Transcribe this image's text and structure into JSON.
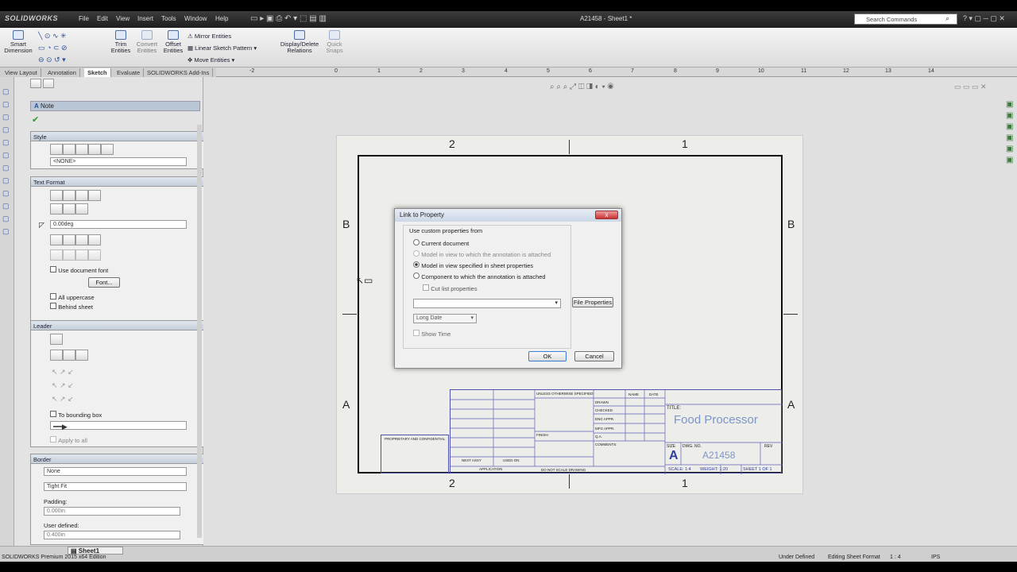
{
  "app": {
    "logo": "SOLIDWORKS",
    "document_title": "A21458 - Sheet1 *",
    "menus": [
      "File",
      "Edit",
      "View",
      "Insert",
      "Tools",
      "Window",
      "Help"
    ],
    "search_placeholder": "Search Commands"
  },
  "ribbon": {
    "smart_dimension": "Smart Dimension",
    "trim": "Trim Entities",
    "convert": "Convert Entities",
    "offset": "Offset Entities",
    "mirror": "Mirror Entities",
    "linear_pattern": "Linear Sketch Pattern",
    "move": "Move Entities",
    "display_delete": "Display/Delete Relations",
    "quick_snaps": "Quick Snaps"
  },
  "tabs": [
    "View Layout",
    "Annotation",
    "Sketch",
    "Evaluate",
    "SOLIDWORKS Add-Ins"
  ],
  "active_tab": "Sketch",
  "ruler": [
    "-2",
    "0",
    "1",
    "2",
    "3",
    "4",
    "5",
    "6",
    "7",
    "8",
    "9",
    "10",
    "11",
    "12",
    "13",
    "14"
  ],
  "property_manager": {
    "title": "Note",
    "style": {
      "header": "Style",
      "combo": "<NONE>"
    },
    "text_format": {
      "header": "Text Format",
      "angle": "0.00deg",
      "use_doc_font": "Use document font",
      "font_button": "Font...",
      "all_upper": "All uppercase",
      "behind_sheet": "Behind sheet"
    },
    "leader": {
      "header": "Leader",
      "bounding": "To bounding box",
      "apply_all": "Apply to all"
    },
    "border": {
      "header": "Border",
      "style": "None",
      "fit": "Tight Fit",
      "padding_label": "Padding:",
      "padding_value": "0.000in",
      "user_defined_label": "User defined:",
      "user_defined_value": "0.400in"
    }
  },
  "sheet": {
    "zones_top": [
      "2",
      "1"
    ],
    "zones_side": [
      "B",
      "A"
    ],
    "title_label": "TITLE:",
    "title": "Food Processor",
    "size_label": "SIZE",
    "size": "A",
    "dwg_label": "DWG.  NO.",
    "dwg_no": "A21458",
    "rev_label": "REV",
    "scale": "SCALE: 1:4",
    "weight": "WEIGHT: 1:20",
    "sheet_of": "SHEET 1 OF 1",
    "name_col": "NAME",
    "date_col": "DATE",
    "drawn": "DRAWN",
    "checked": "CHECKED",
    "eng_appr": "ENG APPR.",
    "mfg_appr": "MFG APPR.",
    "qa": "Q.A.",
    "comments": "COMMENTS:",
    "unless": "UNLESS OTHERWISE SPECIFIED:",
    "proprietary": "PROPRIETARY AND CONFIDENTIAL",
    "finish": "FINISH",
    "do_not_scale": "DO NOT SCALE DRAWING",
    "next_assy": "NEXT ASSY",
    "used_on": "USED ON",
    "application": "APPLICATION"
  },
  "dialog": {
    "title": "Link to Property",
    "close": "x",
    "group_label": "Use custom properties from",
    "options": [
      "Current document",
      "Model in view to which the annotation is attached",
      "Model in view specified in sheet properties",
      "Component to which the annotation is attached"
    ],
    "selected_index": 2,
    "cut_list": "Cut list properties",
    "file_properties": "File Properties",
    "date_format": "Long Date",
    "show_time": "Show Time",
    "ok": "OK",
    "cancel": "Cancel"
  },
  "status": {
    "edition": "SOLIDWORKS Premium 2015 x64 Edition",
    "sheet_tab": "Sheet1",
    "under_defined": "Under Defined",
    "editing": "Editing Sheet Format",
    "scale": "1 : 4",
    "units": "IPS"
  }
}
